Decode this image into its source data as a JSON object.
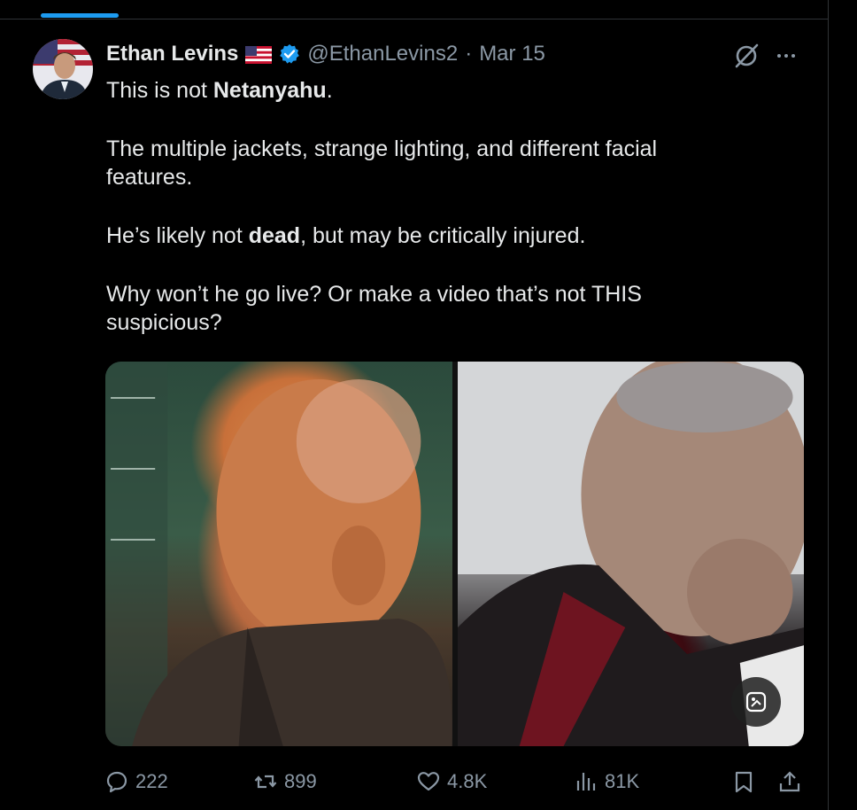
{
  "post": {
    "author_name": "Ethan Levins",
    "handle": "@EthanLevins2",
    "separator": "·",
    "date": "Mar 15",
    "text_line_1a": "This is not ",
    "text_line_1b": "Netanyahu",
    "text_line_1c": ".",
    "text_para_2": "The multiple jackets, strange lighting, and different facial features.",
    "text_para_3a": "He’s likely not ",
    "text_para_3b": "dead",
    "text_para_3c": ", but may be critically injured.",
    "text_para_4": "Why won’t he go live? Or make a video that’s not THIS suspicious?"
  },
  "actions": {
    "replies": "222",
    "reposts": "899",
    "likes": "4.8K",
    "views": "81K"
  },
  "colors": {
    "accent": "#1d9bf0",
    "muted": "#8b98a5",
    "text": "#e7e9ea",
    "background": "#000000"
  },
  "icons": {
    "flag": "us-flag-icon",
    "verified": "verified-badge-icon",
    "grok": "grok-icon",
    "more": "more-dots-icon",
    "reply": "reply-icon",
    "repost": "repost-icon",
    "like": "heart-icon",
    "views": "views-chart-icon",
    "bookmark": "bookmark-icon",
    "share": "share-icon",
    "media_badge": "edit-image-icon"
  }
}
